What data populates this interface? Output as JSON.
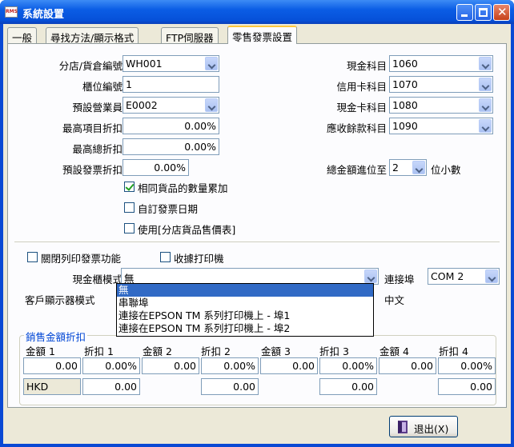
{
  "window": {
    "title": "系統設置",
    "app_icon": "RMS"
  },
  "tabs": [
    "一般",
    "尋找方法/顯示格式",
    "FTP伺服器",
    "零售發票設置"
  ],
  "left": {
    "branch_label": "分店/貨倉編號",
    "branch_value": "WH001",
    "counter_label": "櫃位編號",
    "counter_value": "1",
    "salesman_label": "預設營業員",
    "salesman_value": "E0002",
    "max_item_disc_label": "最高項目折扣",
    "max_item_disc_value": "0.00%",
    "max_total_disc_label": "最高總折扣",
    "max_total_disc_value": "0.00%",
    "default_inv_disc_label": "預設發票折扣",
    "default_inv_disc_value": "0.00%"
  },
  "right": {
    "cash_label": "現金科目",
    "cash_value": "1060",
    "credit_label": "信用卡科目",
    "credit_value": "1070",
    "cashcard_label": "現金卡科目",
    "cashcard_value": "1080",
    "receivable_label": "應收餘款科目",
    "receivable_value": "1090",
    "round_label": "總金額進位至",
    "round_value": "2",
    "round_suffix": "位小數"
  },
  "checks": {
    "sum_qty": "相同貨品的數量累加",
    "custom_date": "自訂發票日期",
    "use_price": "使用[分店貨品售價表]",
    "disable_print": "關閉列印發票功能",
    "receipt_printer": "收據打印機"
  },
  "drawer": {
    "label": "現金櫃模式",
    "value": "無",
    "port_label": "連接埠",
    "port_value": "COM 2"
  },
  "display": {
    "label": "客戶顯示器模式",
    "suffix": "中文"
  },
  "dropdown": [
    "無",
    "串聯埠",
    "連接在EPSON TM 系列打印機上 - 埠1",
    "連接在EPSON TM 系列打印機上 - 埠2"
  ],
  "discount": {
    "title": "銷售金額折扣",
    "headers": [
      "金額 1",
      "折扣 1",
      "金額 2",
      "折扣 2",
      "金額 3",
      "折扣 3",
      "金額 4",
      "折扣 4"
    ],
    "row1": [
      "0.00",
      "0.00%",
      "0.00",
      "0.00%",
      "0.00",
      "0.00%",
      "0.00",
      "0.00%"
    ],
    "row2_label": "HKD",
    "row2": [
      "0.00",
      "0.00",
      "0.00",
      "0.00"
    ]
  },
  "exit": {
    "label": "退出(X)"
  }
}
